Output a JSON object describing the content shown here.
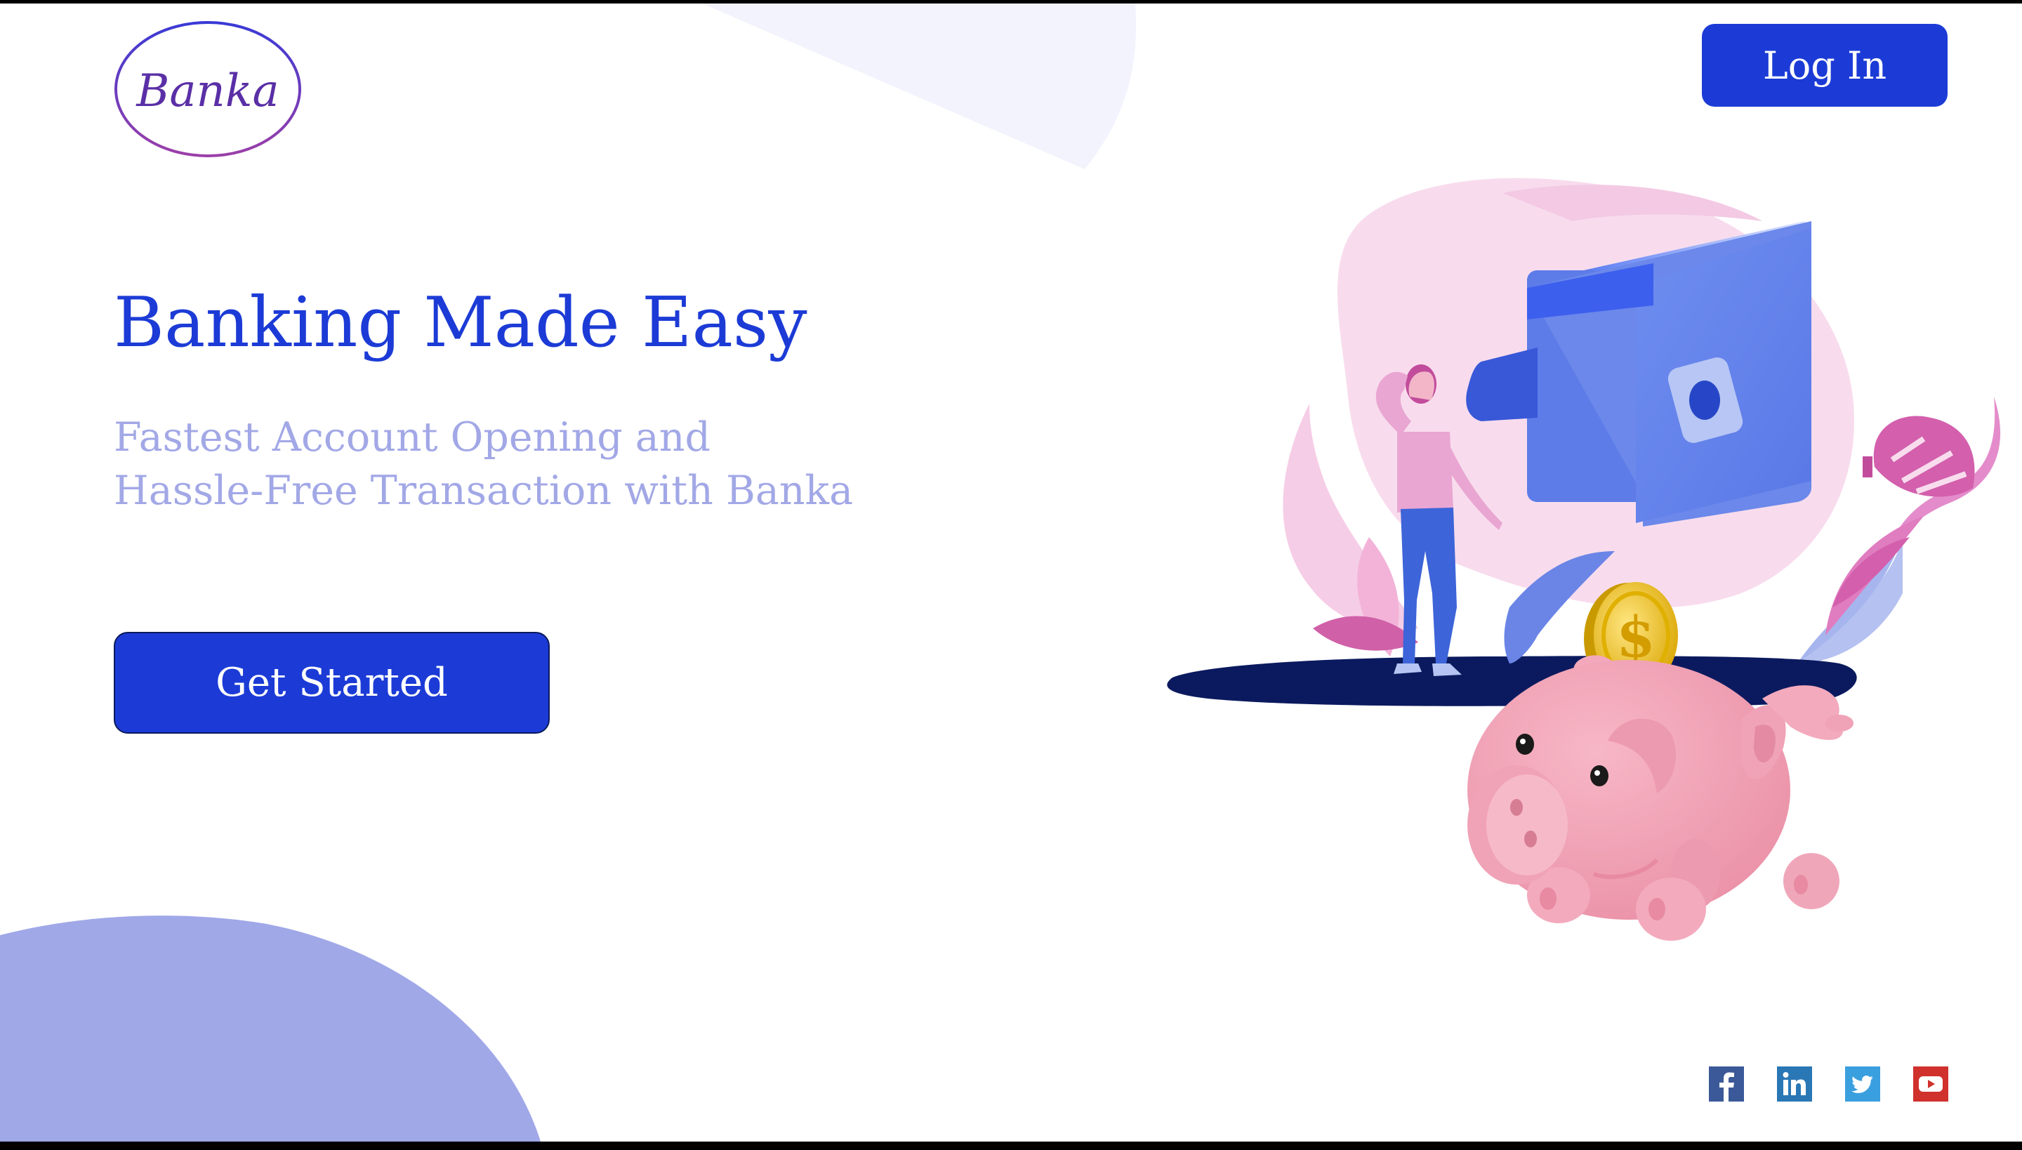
{
  "header": {
    "logo_text": "Banka",
    "login_label": "Log In"
  },
  "hero": {
    "title": "Banking Made Easy",
    "subtitle_lines": [
      "Fastest Account Opening and",
      "Hassle-Free Transaction with Banka"
    ],
    "cta_label": "Get Started"
  },
  "socials": [
    {
      "name": "facebook",
      "icon": "facebook-icon",
      "color": "#3b5998"
    },
    {
      "name": "linkedin",
      "icon": "linkedin-icon",
      "color": "#2a77b5"
    },
    {
      "name": "twitter",
      "icon": "twitter-icon",
      "color": "#3a9fdf"
    },
    {
      "name": "youtube",
      "icon": "youtube-icon",
      "color": "#d0312d"
    }
  ],
  "colors": {
    "brand_blue": "#1c3bd6",
    "subtitle": "#a2a8e6",
    "blob": "#a0a8e8",
    "logo_purple": "#5a2fa6"
  }
}
